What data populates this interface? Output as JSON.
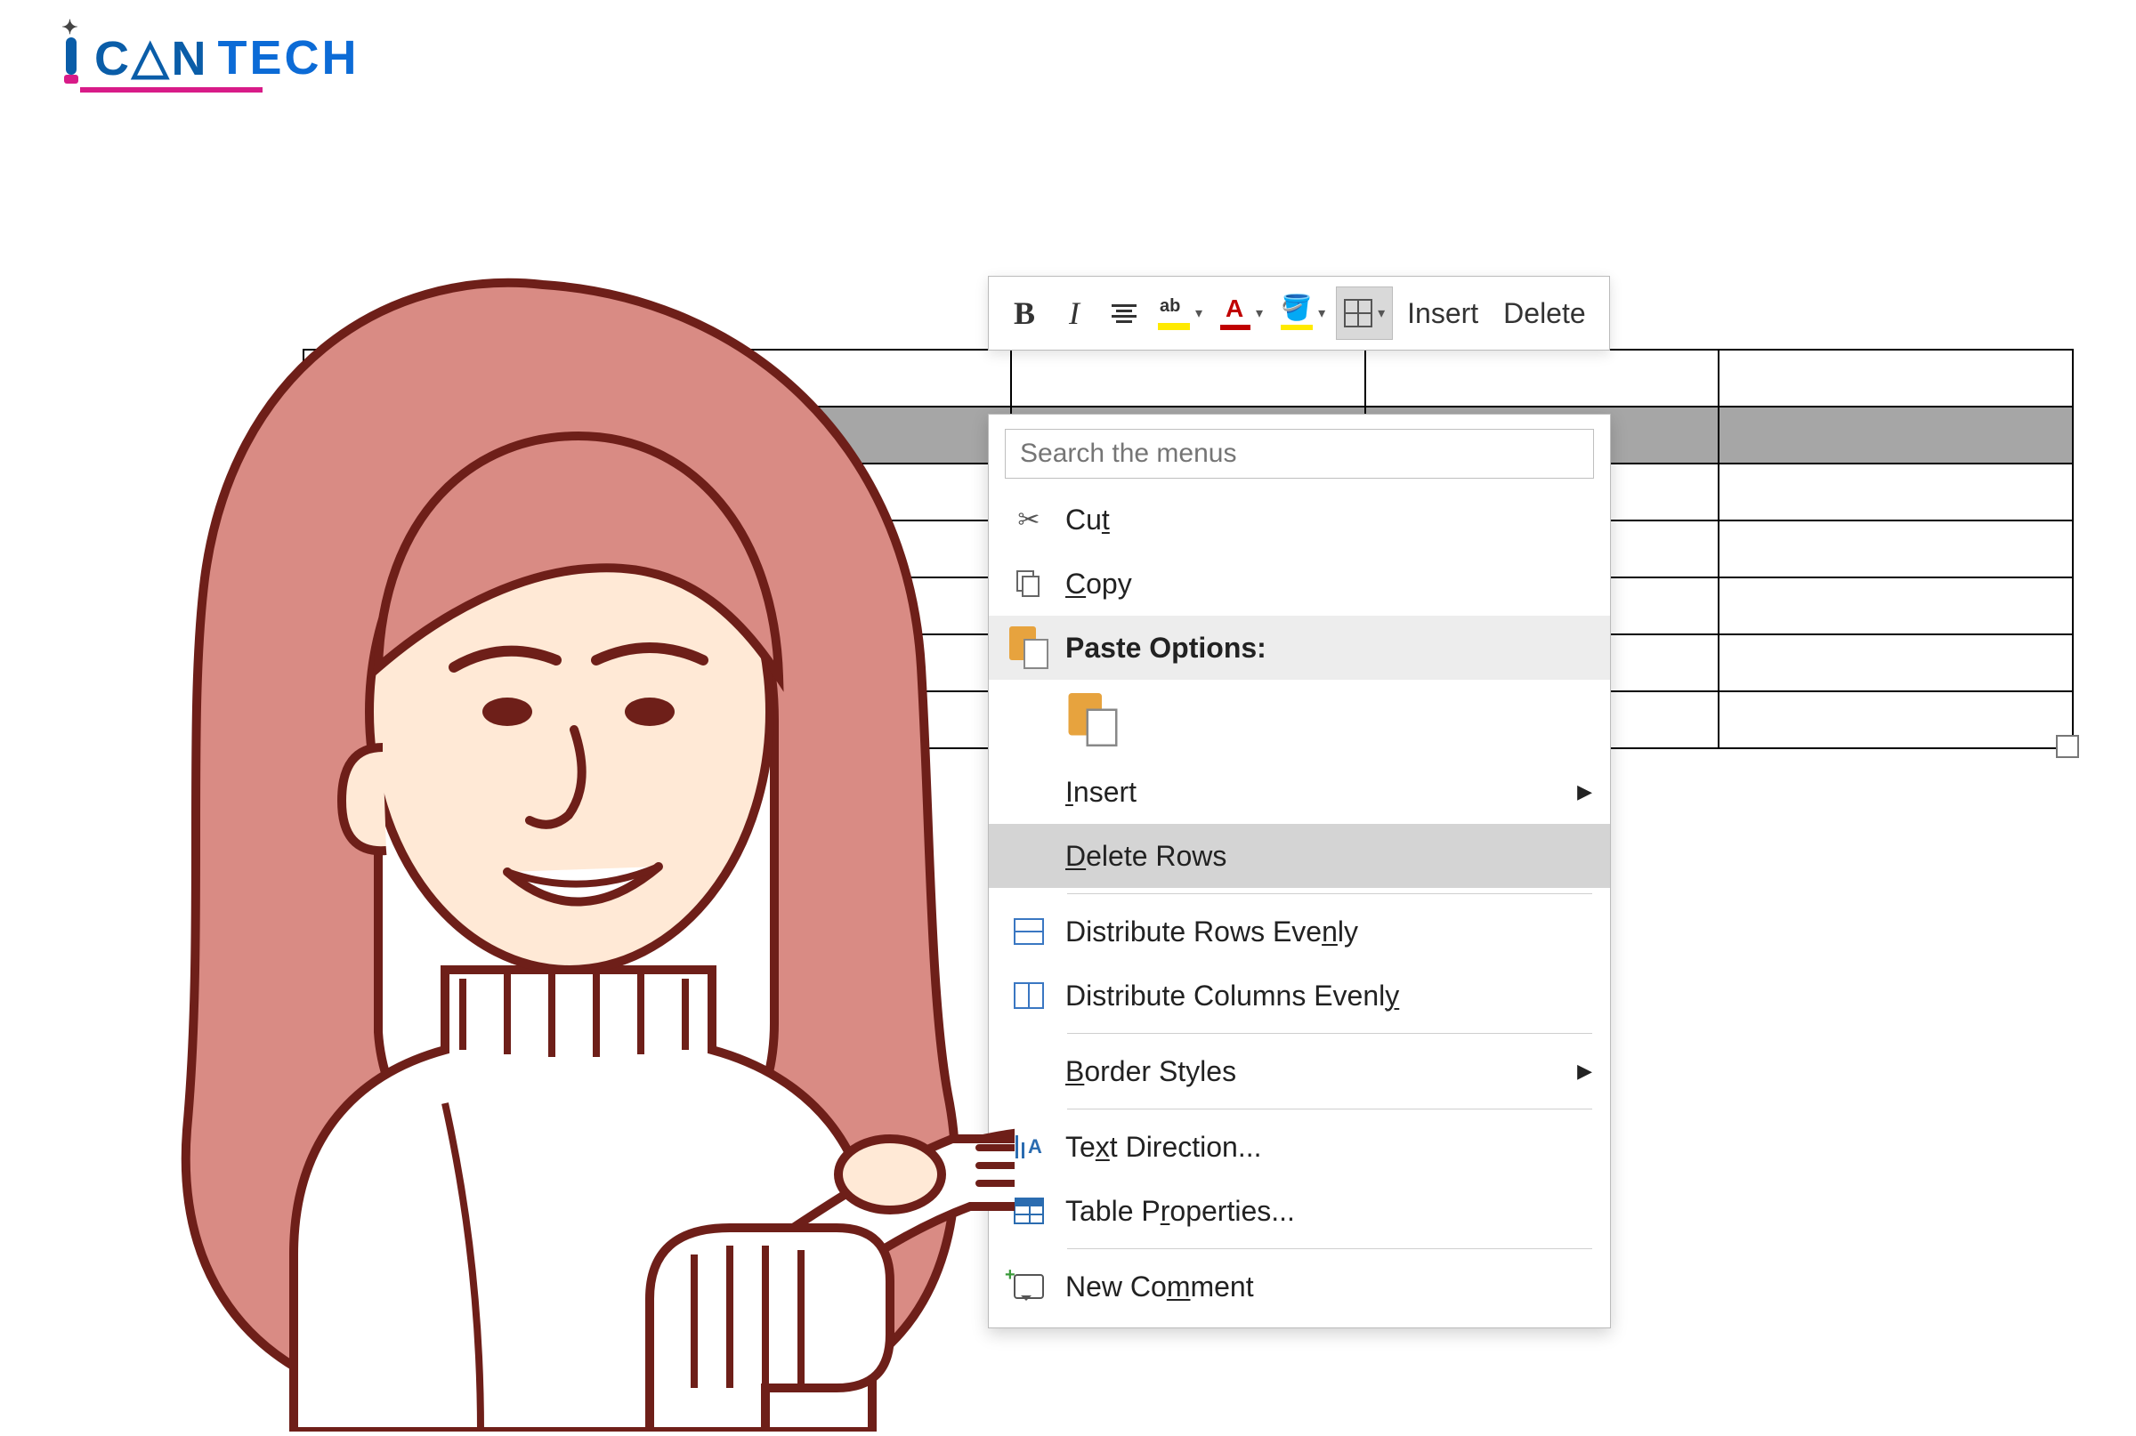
{
  "logo": {
    "part1": "CAN",
    "part2": "TECH"
  },
  "mini_toolbar": {
    "bold": "B",
    "italic": "I",
    "highlight_text": "ab",
    "font_color_letter": "A",
    "insert": "Insert",
    "delete": "Delete"
  },
  "context_menu": {
    "search_placeholder": "Search the menus",
    "cut_pre": "Cu",
    "cut_u": "t",
    "cut_post": "",
    "copy_pre": "",
    "copy_u": "C",
    "copy_post": "opy",
    "paste_label": "Paste Options:",
    "insert_pre": "",
    "insert_u": "I",
    "insert_post": "nsert",
    "delrows_pre": "",
    "delrows_u": "D",
    "delrows_post": "elete Rows",
    "distrow_pre": "Distribute Rows Eve",
    "distrow_u": "n",
    "distrow_post": "ly",
    "distcol_pre": "Distribute Columns Evenl",
    "distcol_u": "y",
    "distcol_post": "",
    "border_pre": "",
    "border_u": "B",
    "border_post": "order Styles",
    "textdir_pre": "Te",
    "textdir_u": "x",
    "textdir_post": "t Direction...",
    "tblprop_pre": "Table P",
    "tblprop_u": "r",
    "tblprop_post": "operties...",
    "comment_pre": "New Co",
    "comment_u": "m",
    "comment_post": "ment"
  }
}
